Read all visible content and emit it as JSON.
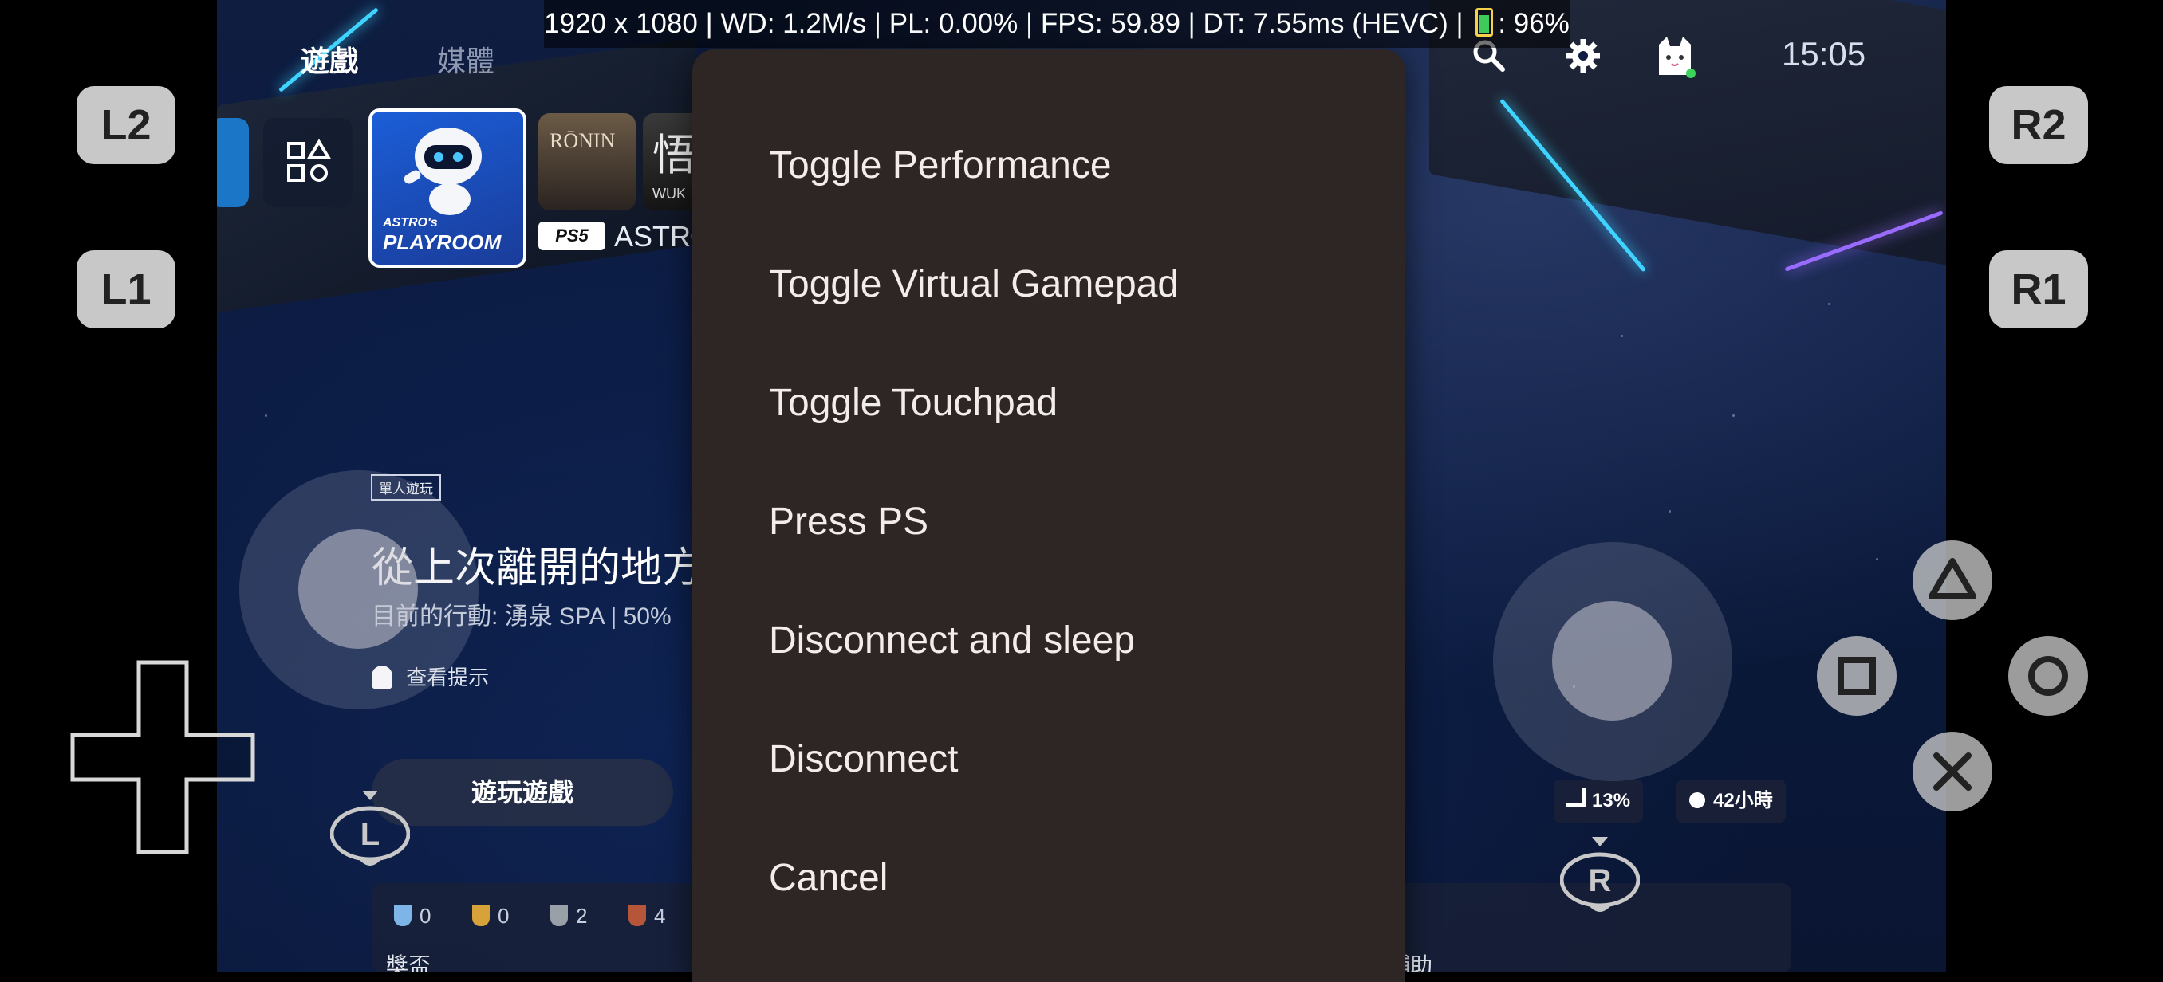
{
  "osd": {
    "resolution": "1920 x 1080",
    "network": "WD: 1.2M/s",
    "packet_loss": "PL: 0.00%",
    "fps": "FPS: 59.89",
    "decode": "DT: 7.55ms (HEVC)",
    "battery": "96%",
    "separator": "|"
  },
  "ps_home": {
    "tabs": [
      "遊戲",
      "媒體"
    ],
    "clock": "15:05",
    "icons": [
      "search-icon",
      "settings-icon",
      "profile-avatar"
    ],
    "tiles": {
      "astro": {
        "line1": "ASTRO's",
        "line2": "PLAYROOM"
      },
      "ronin": "RŌNIN",
      "wukong_top": "悟",
      "wukong_bottom": "WUK",
      "platform_badge": "PS5",
      "game_name_peek": "ASTRO"
    },
    "badge_single": "單人遊玩",
    "resume_title": "從上次離開的地方",
    "resume_subtitle": "目前的行動:   湧泉 SPA | 50%",
    "hint": "查看提示",
    "play_button": "遊玩遊戲",
    "stats": {
      "progress": "13%",
      "playtime": "42小時"
    },
    "trophies": [
      {
        "type": "platinum",
        "count": "0",
        "color": "#7db5e8"
      },
      {
        "type": "gold",
        "count": "0",
        "color": "#d8a23a"
      },
      {
        "type": "silver",
        "count": "2",
        "color": "#9aa0a8"
      },
      {
        "type": "bronze",
        "count": "4",
        "color": "#b5563a"
      }
    ],
    "panel_left_label": "獎盃",
    "panel_right_label": "輔助"
  },
  "controls": {
    "l2": "L2",
    "l1": "L1",
    "r2": "R2",
    "r1": "R1",
    "l3": "L",
    "r3": "R"
  },
  "menu": {
    "items": [
      "Toggle Performance",
      "Toggle Virtual Gamepad",
      "Toggle Touchpad",
      "Press PS",
      "Disconnect and sleep",
      "Disconnect",
      "Cancel"
    ]
  }
}
